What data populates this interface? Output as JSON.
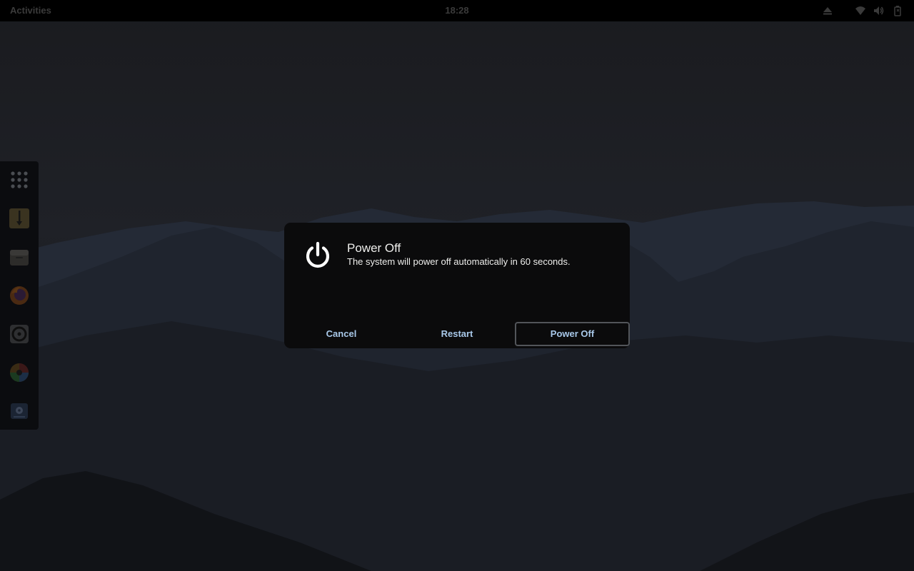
{
  "topbar": {
    "activities_label": "Activities",
    "clock": "18:28",
    "tray_icons": [
      "eject-icon",
      "wifi-icon",
      "volume-icon",
      "battery-icon"
    ]
  },
  "dock": {
    "items": [
      {
        "name": "show-apps-icon"
      },
      {
        "name": "terminal-icon"
      },
      {
        "name": "files-icon"
      },
      {
        "name": "firefox-icon"
      },
      {
        "name": "rhythmbox-icon"
      },
      {
        "name": "color-wheel-icon"
      },
      {
        "name": "disk-app-icon"
      }
    ]
  },
  "dialog": {
    "icon": "power-icon",
    "title": "Power Off",
    "message": "The system will power off automatically in 60 seconds.",
    "buttons": {
      "cancel": "Cancel",
      "restart": "Restart",
      "power_off": "Power Off"
    },
    "colors": {
      "button_text": "#a9c9ea",
      "dialog_bg": "#0b0b0c"
    }
  }
}
